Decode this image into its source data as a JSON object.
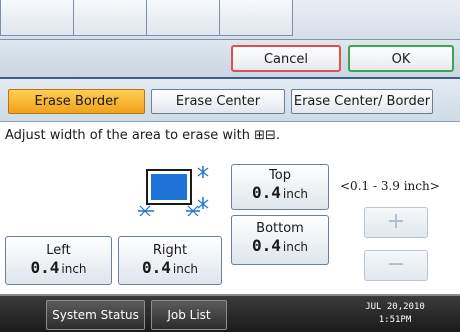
{
  "action_bar": {
    "cancel_label": "Cancel",
    "ok_label": "OK"
  },
  "tabs": [
    {
      "label": "Erase Border",
      "selected": true
    },
    {
      "label": "Erase Center",
      "selected": false
    },
    {
      "label": "Erase Center/ Border",
      "selected": false
    }
  ],
  "instruction": "Adjust width of the area to erase with ⊞⊟.",
  "values": {
    "top": {
      "label": "Top",
      "value": "0.4",
      "unit": "inch"
    },
    "bottom": {
      "label": "Bottom",
      "value": "0.4",
      "unit": "inch"
    },
    "left": {
      "label": "Left",
      "value": "0.4",
      "unit": "inch"
    },
    "right": {
      "label": "Right",
      "value": "0.4",
      "unit": "inch"
    }
  },
  "range_hint": "<0.1 - 3.9 inch>",
  "stepper": {
    "plus_symbol": "+",
    "minus_symbol": "−",
    "enabled": false
  },
  "status_bar": {
    "system_status_label": "System Status",
    "job_list_label": "Job List",
    "date": "JUL  20,2010",
    "time": "1:51PM"
  },
  "colors": {
    "selected_tab": "#f4b73a",
    "cancel_border": "#e2504e",
    "ok_border": "#3fa44b",
    "page_fill": "#1f73d6",
    "status_bar_bg": "#2a2a2a"
  },
  "icons": {
    "page_diagram": "erase-border-diagram-icon",
    "plus": "plus-icon",
    "minus": "minus-icon"
  }
}
